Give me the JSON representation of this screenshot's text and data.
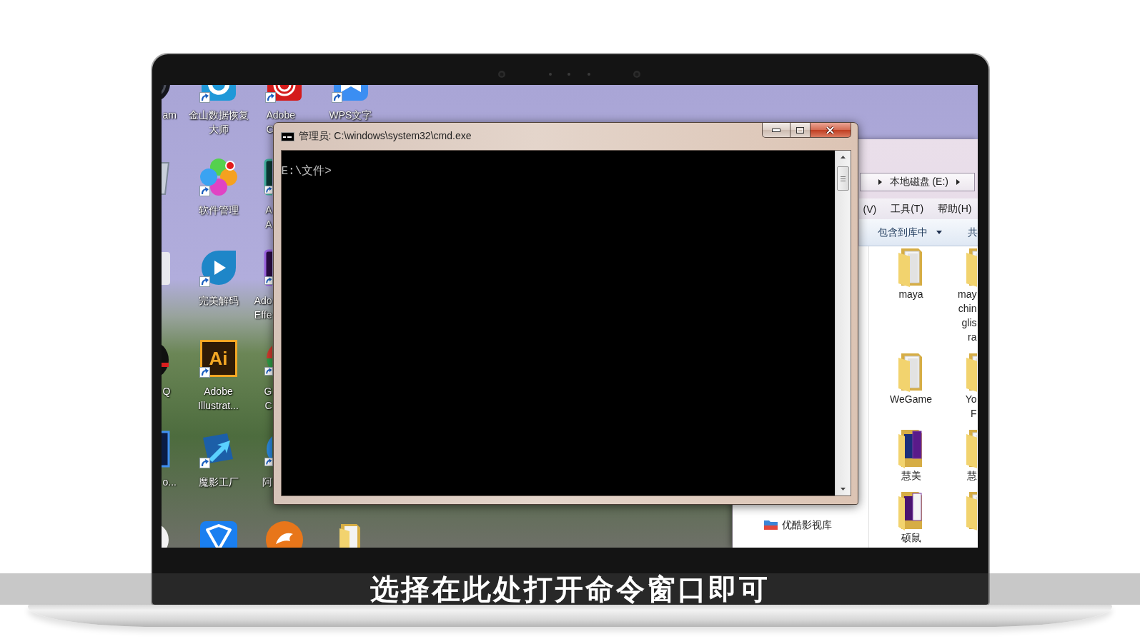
{
  "desktop_icons": [
    {
      "label": "am",
      "shortcut": false
    },
    {
      "label": "金山数据恢复大师",
      "shortcut": true
    },
    {
      "label": "Adobe\nC",
      "shortcut": true
    },
    {
      "label": "WPS文字",
      "shortcut": true
    },
    {
      "shortcut": false
    },
    {
      "label": "软件管理",
      "shortcut": true
    },
    {
      "label": "A\nA",
      "shortcut": true
    },
    {
      "shortcut": false
    },
    {
      "label": "完美解码",
      "shortcut": true
    },
    {
      "label": "Ado\nEffe",
      "shortcut": true
    },
    {
      "label": "Q",
      "shortcut": false
    },
    {
      "label": "Adobe\nIllustrat...",
      "shortcut": true,
      "logo_text": "Ai"
    },
    {
      "label": "G\nC",
      "shortcut": true
    },
    {
      "label": "o...",
      "shortcut": false
    },
    {
      "label": "魔影工厂",
      "shortcut": true
    },
    {
      "label": "阿",
      "shortcut": true
    },
    {
      "shortcut": false
    },
    {
      "shortcut": false
    },
    {
      "shortcut": false
    },
    {
      "shortcut": false
    }
  ],
  "cmd_window": {
    "title": "管理员: C:\\windows\\system32\\cmd.exe",
    "lines": [
      "E:\\文件>"
    ]
  },
  "explorer_window": {
    "breadcrumbs": [
      "本地磁盘 (E:)"
    ],
    "menu": [
      "(V)",
      "工具(T)",
      "帮助(H)"
    ],
    "toolbar": [
      {
        "label": "包含到库中",
        "dropdown": true
      },
      {
        "label": "共",
        "dropdown": false
      }
    ],
    "nav_items": [
      "优酷影视库"
    ],
    "files": [
      {
        "name": "maya",
        "kind": "folder"
      },
      {
        "name": "may\nchin\nglis\nra",
        "kind": "folder"
      },
      {
        "name": "WeGame",
        "kind": "folder"
      },
      {
        "name": "Yo\nF",
        "kind": "folder"
      },
      {
        "name": "慧美",
        "kind": "preview"
      },
      {
        "name": "慧",
        "kind": "folder"
      },
      {
        "name": "硕鼠",
        "kind": "preview"
      },
      {
        "kind": "folder"
      }
    ]
  },
  "subtitle": "选择在此处打开命令窗口即可"
}
